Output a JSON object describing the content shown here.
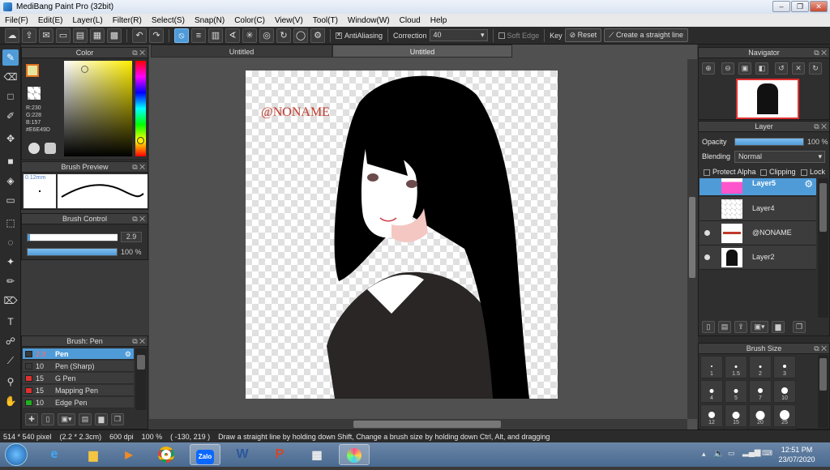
{
  "window": {
    "title": "MediBang Paint Pro (32bit)",
    "minimize": "–",
    "maximize": "❐",
    "close": "✕"
  },
  "menu": [
    "File(F)",
    "Edit(E)",
    "Layer(L)",
    "Filter(R)",
    "Select(S)",
    "Snap(N)",
    "Color(C)",
    "View(V)",
    "Tool(T)",
    "Window(W)",
    "Cloud",
    "Help"
  ],
  "toolbar": {
    "antialiasing_label": "AntiAliasing",
    "correction_label": "Correction",
    "correction_value": "40",
    "soft_edge_label": "Soft Edge",
    "key_label": "Key",
    "reset_label": "Reset",
    "straight_line_label": "Create a straight line"
  },
  "color_panel": {
    "title": "Color",
    "r": "R:230",
    "g": "G:228",
    "b": "B:157",
    "hex": "#E6E49D",
    "primary_color": "#E6E49D"
  },
  "brush_preview": {
    "title": "Brush Preview",
    "size": "0.12mm"
  },
  "brush_control": {
    "title": "Brush Control",
    "size_value": "2.9",
    "opacity_value": "100 %",
    "opacity_fraction": 1.0
  },
  "brush_list": {
    "title": "Brush: Pen",
    "items": [
      {
        "size": "2.9",
        "name": "Pen",
        "color": "#3a3a3a"
      },
      {
        "size": "10",
        "name": "Pen (Sharp)",
        "color": "#3a3a3a"
      },
      {
        "size": "15",
        "name": "G Pen",
        "color": "#e03030"
      },
      {
        "size": "15",
        "name": "Mapping Pen",
        "color": "#e03030"
      },
      {
        "size": "10",
        "name": "Edge Pen",
        "color": "#20b020"
      }
    ]
  },
  "tabs": [
    "Untitled",
    "Untitled"
  ],
  "canvas": {
    "watermark": "@NONAME"
  },
  "navigator": {
    "title": "Navigator"
  },
  "layer_panel": {
    "title": "Layer",
    "opacity_label": "Opacity",
    "opacity_value": "100 %",
    "opacity_fraction": 1.0,
    "blending_label": "Blending",
    "blending_value": "Normal",
    "protect_alpha": "Protect Alpha",
    "clipping": "Clipping",
    "lock": "Lock",
    "layers": [
      {
        "name": "Layer5"
      },
      {
        "name": "Layer4"
      },
      {
        "name": "@NONAME"
      },
      {
        "name": "Layer2"
      }
    ]
  },
  "brush_size": {
    "title": "Brush Size",
    "sizes": [
      "1",
      "1.5",
      "2",
      "3",
      "4",
      "5",
      "7",
      "10",
      "12",
      "15",
      "20",
      "25",
      "30",
      "40",
      "50",
      "70"
    ]
  },
  "status": {
    "dimensions": "514 * 540 pixel",
    "physical": "(2.2 * 2.3cm)",
    "dpi": "600 dpi",
    "zoom": "100 %",
    "coords": "( -130, 219 )",
    "hint": "Draw a straight line by holding down Shift, Change a brush size by holding down Ctrl, Alt, and dragging"
  },
  "taskbar": {
    "time": "12:51 PM",
    "date": "23/07/2020",
    "zalo": "Zalo"
  }
}
